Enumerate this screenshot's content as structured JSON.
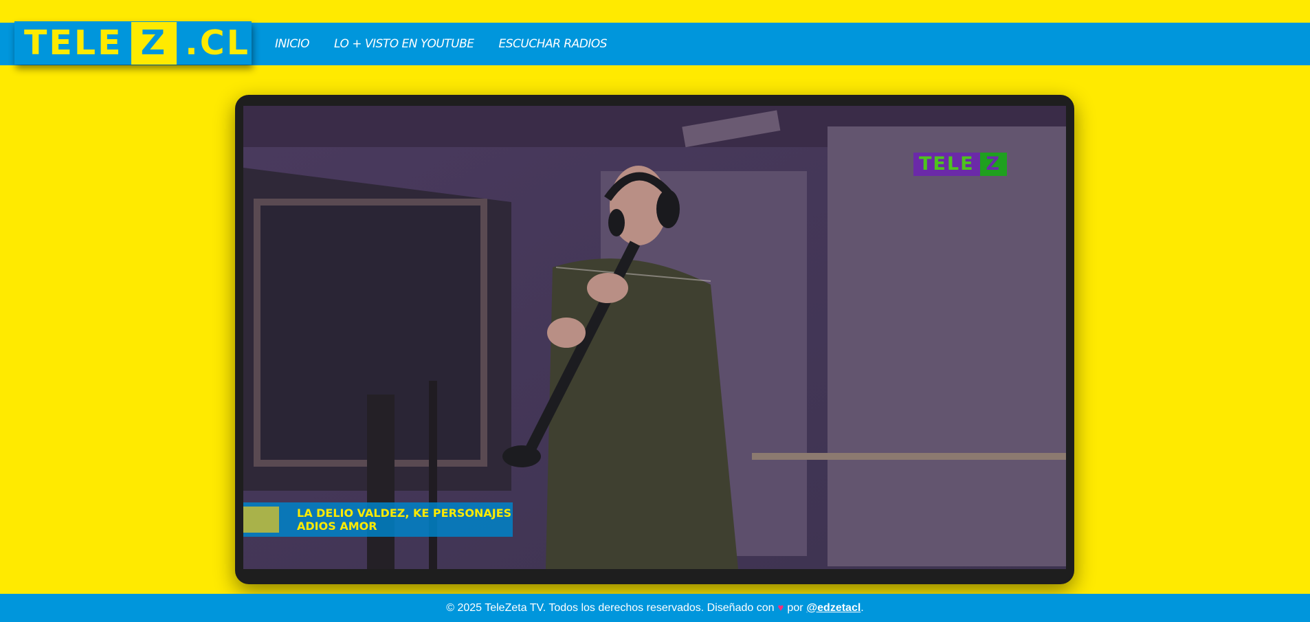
{
  "brand": {
    "logo_left": "TELE",
    "logo_z": "Z",
    "logo_right": ".CL"
  },
  "nav": {
    "items": [
      "INICIO",
      "LO + VISTO EN YOUTUBE",
      "ESCUCHAR RADIOS"
    ]
  },
  "video": {
    "watermark_left": "TELE",
    "watermark_z": "Z",
    "caption_line1": "LA DELIO VALDEZ, KE PERSONAJES",
    "caption_line2": "ADIOS AMOR"
  },
  "footer": {
    "text_before": "© 2025 TeleZeta TV. Todos los derechos reservados. Diseñado con",
    "heart": "♥",
    "text_por": "por",
    "author": "@edzetacl",
    "text_after": "."
  },
  "colors": {
    "background": "#FFEA00",
    "bar": "#0096DC",
    "player": "#1e1e1e"
  }
}
